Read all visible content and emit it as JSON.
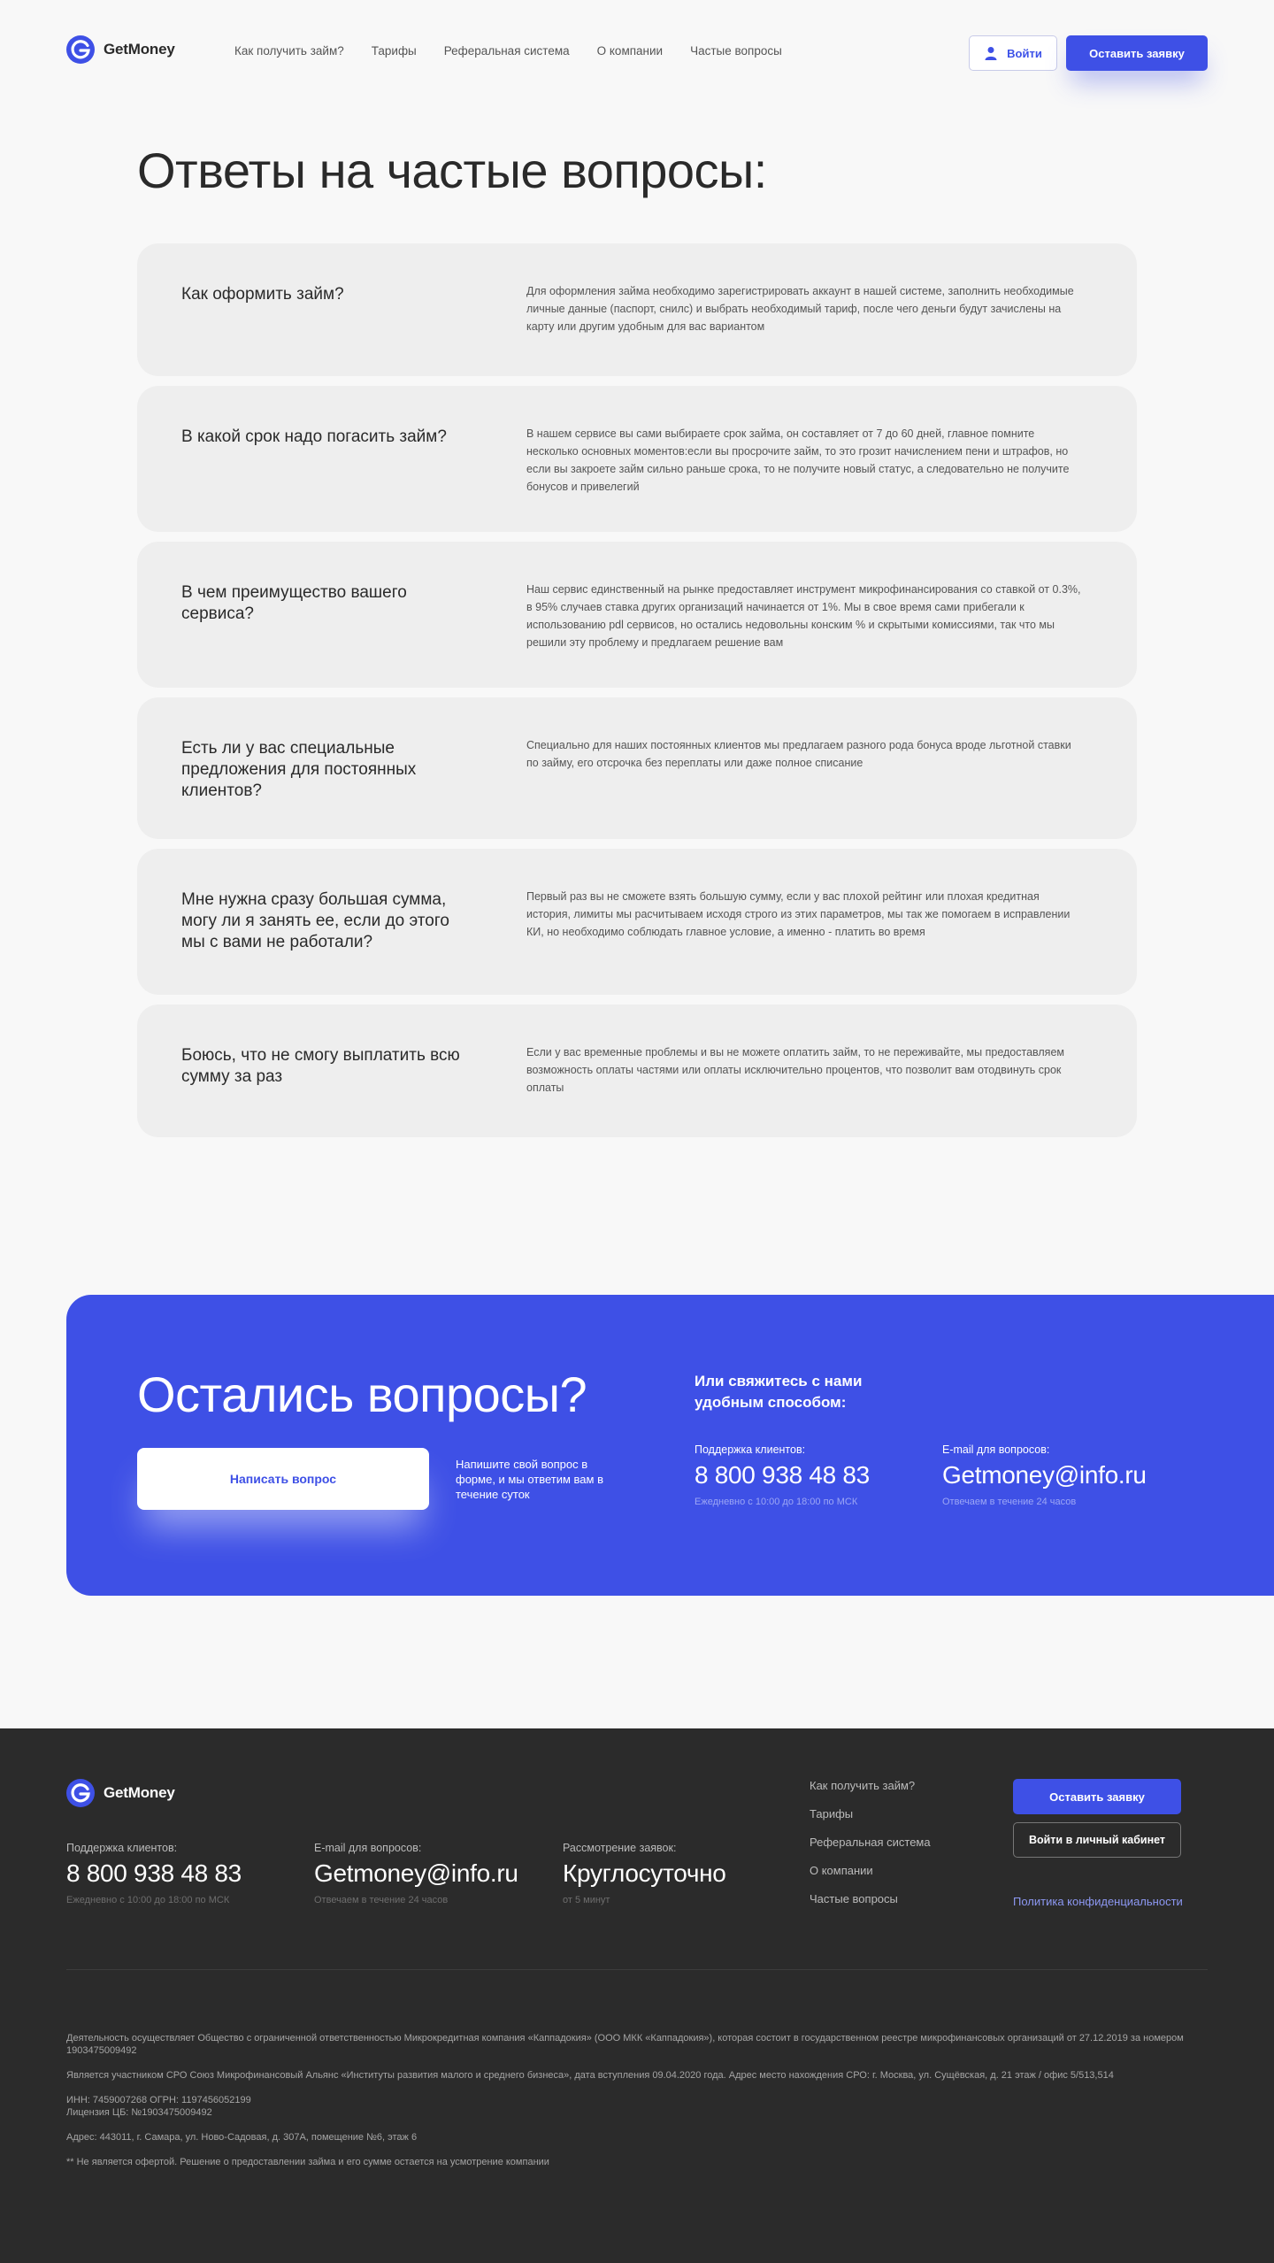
{
  "brand": {
    "name": "GetMoney",
    "accent": "#3e50e6"
  },
  "header": {
    "nav": [
      "Как получить займ?",
      "Тарифы",
      "Реферальная система",
      "О компании",
      "Частые вопросы"
    ],
    "login_label": "Войти",
    "apply_label": "Оставить заявку"
  },
  "faq": {
    "title": "Ответы на частые вопросы:",
    "items": [
      {
        "question": "Как оформить займ?",
        "answer": "Для оформления займа необходимо зарегистрировать аккаунт в нашей системе, заполнить необходимые личные данные (паспорт, снилс) и выбрать необходимый тариф, после чего деньги будут зачислены на карту или другим удобным для вас вариантом"
      },
      {
        "question": "В какой срок надо погасить займ?",
        "answer": "В нашем сервисе вы сами выбираете срок займа, он составляет от 7 до 60 дней, главное помните несколько основных моментов:если вы просрочите займ, то это грозит начислением пени и штрафов, но если вы закроете займ сильно раньше срока, то не получите новый статус, а следовательно не получите бонусов и привелегий"
      },
      {
        "question": "В чем преимущество вашего сервиса?",
        "answer": "Наш сервис единственный на рынке предоставляет инструмент микрофинансирования со ставкой от 0.3%, в 95% случаев ставка других организаций начинается от 1%. Мы в свое время сами прибегали к использованию pdl сервисов, но остались недовольны конским % и скрытыми комиссиями, так что мы решили эту проблему и предлагаем решение вам"
      },
      {
        "question": "Есть ли у вас специальные предложения для постоянных клиентов?",
        "answer": "Специально для наших постоянных клиентов мы предлагаем разного рода бонуса вроде льготной ставки по займу, его отсрочка без переплаты или даже полное списание"
      },
      {
        "question": "Мне нужна сразу большая сумма, могу ли я занять ее, если до этого мы с вами не работали?",
        "answer": "Первый раз вы не сможете взять большую сумму, если у вас плохой рейтинг или плохая кредитная история, лимиты мы расчитываем исходя строго из этих параметров, мы так же помогаем в исправлении КИ, но необходимо соблюдать главное условие, а именно - платить во время"
      },
      {
        "question": "Боюсь, что не смогу выплатить всю сумму за раз",
        "answer": "Если у вас временные проблемы и вы не можете оплатить займ, то не переживайте, мы предоставляем возможность оплаты частями или оплаты исключительно процентов, что позволит вам отодвинуть срок оплаты"
      }
    ]
  },
  "contact": {
    "title": "Остались вопросы?",
    "ask_button": "Написать вопрос",
    "ask_note": "Напишите свой вопрос в форме, и мы ответим вам в течение суток",
    "subtitle": "Или свяжитесь с нами удобным способом:",
    "support_label": "Поддержка клиентов:",
    "support_phone": "8 800 938 48 83",
    "support_hours": "Ежедневно с 10:00 до 18:00 по МСК",
    "email_label": "E-mail для вопросов:",
    "email": "Getmoney@info.ru",
    "email_note": "Отвечаем в течение 24 часов"
  },
  "footer": {
    "support_label": "Поддержка клиентов:",
    "support_phone": "8 800 938 48 83",
    "support_hours": "Ежедневно с 10:00 до 18:00 по МСК",
    "email_label": "E-mail для вопросов:",
    "email": "Getmoney@info.ru",
    "email_note": "Отвечаем в течение 24 часов",
    "review_label": "Рассмотрение заявок:",
    "review_value": "Круглосуточно",
    "review_note": "от 5 минут",
    "nav": [
      "Как получить займ?",
      "Тарифы",
      "Реферальная система",
      "О компании",
      "Частые вопросы"
    ],
    "apply_label": "Оставить заявку",
    "cabinet_label": "Войти в личный кабинет",
    "privacy_label": "Политика конфиденциальности",
    "legal": [
      "Деятельность осуществляет Общество с ограниченной ответственностью Микрокредитная компания «Каппадокия» (ООО МКК «Каппадокия»), которая состоит в государственном реестре микрофинансовых организаций от 27.12.2019 за номером 1903475009492",
      "Является участником СРО Союз Микрофинансовый Альянс «Институты развития малого и среднего бизнеса», дата вступления 09.04.2020 года. Адрес место нахождения СРО: г. Москва, ул. Сущёвская, д. 21 этаж / офис 5/513,514",
      "ИНН: 7459007268 ОГРН: 1197456052199",
      "Лицензия ЦБ: №1903475009492",
      "Адрес: 443011, г. Самара, ул. Ново-Садовая, д. 307А, помещение №6, этаж 6",
      "** Не является офертой. Решение о предоставлении займа и его сумме остается на усмотрение компании"
    ]
  }
}
